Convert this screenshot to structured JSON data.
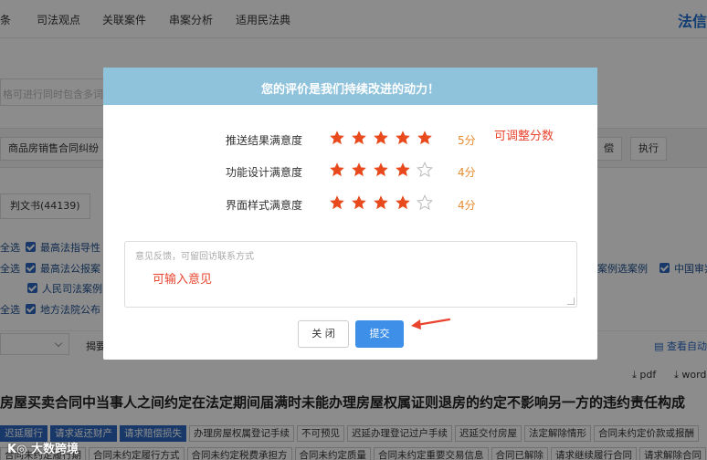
{
  "nav": {
    "items": [
      "条",
      "司法观点",
      "关联案件",
      "串案分析",
      "适用民法典"
    ],
    "brand": "法信"
  },
  "search": {
    "placeholder": "格可进行同时包含多词全"
  },
  "filter": {
    "tag": "商品房销售合同纠纷",
    "chips": [
      "偿",
      "执行"
    ]
  },
  "doc_tab": "判文书(44139)",
  "sources": {
    "select_all": "全选",
    "rows": [
      {
        "all": "全选",
        "label": "最高法指导性"
      },
      {
        "all": "全选",
        "label": "最高法公报案"
      },
      {
        "all": "",
        "label": "人民司法案例"
      },
      {
        "all": "全选",
        "label": "地方法院公布"
      }
    ],
    "right_items": [
      "案例选案例",
      "中国审判"
    ]
  },
  "sort": {
    "label": "揭要",
    "view_link": "查看自动"
  },
  "downloads": [
    "pdf",
    "word"
  ],
  "result": {
    "title": "房屋买卖合同中当事人之间约定在法定期间届满时未能办理房屋权属证则退房的约定不影响另一方的违约责任构成",
    "tags_row1": [
      "迟延履行",
      "请求返还财产",
      "请求赔偿损失",
      "办理房屋权属登记手续",
      "不可预见",
      "迟延办理登记过户手续",
      "迟延交付房屋",
      "法定解除情形",
      "合同未约定价款或报酬"
    ],
    "tags_row2": [
      "合同未约定履行期",
      "合同未约定履行方式",
      "合同未约定税费承担方",
      "合同未约定质量",
      "合同未约定重要交易信息",
      "合同已解除",
      "请求继续履行合同",
      "请求解除合同"
    ]
  },
  "watermark": "大数跨境",
  "modal": {
    "title": "您的评价是我们持续改进的动力！",
    "ratings": [
      {
        "label": "推送结果满意度",
        "stars": 5,
        "max": 5,
        "score": "5分"
      },
      {
        "label": "功能设计满意度",
        "stars": 4,
        "max": 5,
        "score": "4分"
      },
      {
        "label": "界面样式满意度",
        "stars": 4,
        "max": 5,
        "score": "4分"
      }
    ],
    "annotation_adjust": "可调整分数",
    "feedback_placeholder": "意见反馈，可留回访联系方式",
    "annotation_input": "可输入意见",
    "close_label": "关 闭",
    "submit_label": "提交"
  },
  "colors": {
    "header_bg": "#8fc3dc",
    "star": "#e84a1e",
    "score": "#e88a2e",
    "annotation": "#e8442e",
    "submit": "#3d8fe8",
    "brand": "#1f6fd1"
  }
}
